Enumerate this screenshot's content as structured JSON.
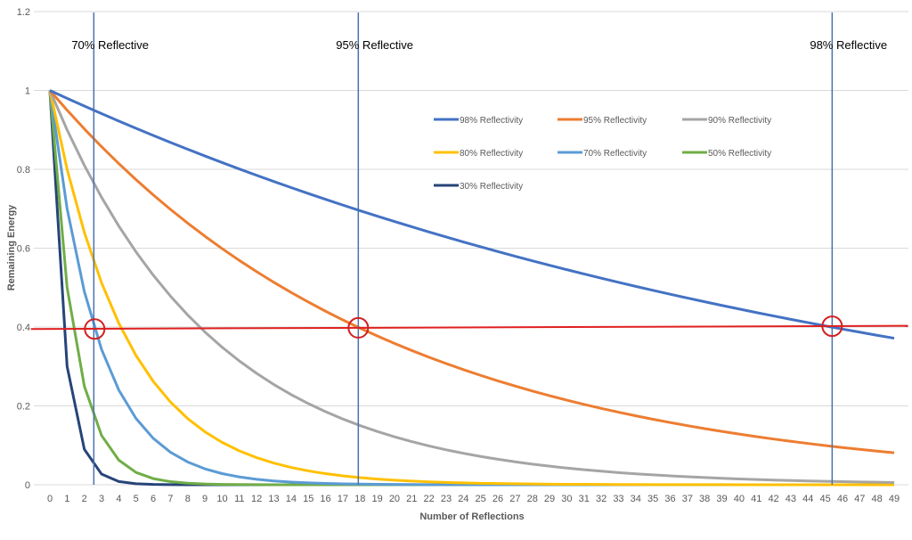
{
  "chart_data": {
    "type": "line",
    "title": "",
    "xlabel": "Number of Reflections",
    "ylabel": "Remaining Energy",
    "xlim": [
      0,
      49
    ],
    "ylim": [
      0,
      1.2
    ],
    "yticks": [
      0,
      0.2,
      0.4,
      0.6,
      0.8,
      1,
      1.2
    ],
    "ytick_labels": [
      "0",
      "0.2",
      "0.4",
      "0.6",
      "0.8",
      "1",
      "1.2"
    ],
    "x": [
      0,
      1,
      2,
      3,
      4,
      5,
      6,
      7,
      8,
      9,
      10,
      11,
      12,
      13,
      14,
      15,
      16,
      17,
      18,
      19,
      20,
      21,
      22,
      23,
      24,
      25,
      26,
      27,
      28,
      29,
      30,
      31,
      32,
      33,
      34,
      35,
      36,
      37,
      38,
      39,
      40,
      41,
      42,
      43,
      44,
      45,
      46,
      47,
      48,
      49
    ],
    "grid": "horizontal",
    "legend_position": "upper-right inside plot",
    "series": [
      {
        "name": "98% Reflectivity",
        "reflectivity": 0.98,
        "color": "#4472C4",
        "formula": "0.98^n"
      },
      {
        "name": "95% Reflectivity",
        "reflectivity": 0.95,
        "color": "#ED7D31",
        "formula": "0.95^n"
      },
      {
        "name": "90% Reflectivity",
        "reflectivity": 0.9,
        "color": "#A5A5A5",
        "formula": "0.90^n"
      },
      {
        "name": "80% Reflectivity",
        "reflectivity": 0.8,
        "color": "#FFC000",
        "formula": "0.80^n"
      },
      {
        "name": "70% Reflectivity",
        "reflectivity": 0.7,
        "color": "#5B9BD5",
        "formula": "0.70^n"
      },
      {
        "name": "50% Reflectivity",
        "reflectivity": 0.5,
        "color": "#70AD47",
        "formula": "0.50^n"
      },
      {
        "name": "30% Reflectivity",
        "reflectivity": 0.3,
        "color": "#264478",
        "formula": "0.30^n"
      }
    ],
    "threshold_line": {
      "label": "",
      "y_start": 0.395,
      "y_end": 0.403,
      "x_start": -1.1,
      "x_end": 49.8,
      "color": "#E02020"
    },
    "vertical_markers": [
      {
        "label": "70% Reflective",
        "x": 2.55,
        "color": "#4A72B0"
      },
      {
        "label": "95% Reflective",
        "x": 17.9,
        "color": "#4A72B0"
      },
      {
        "label": "98% Reflective",
        "x": 45.4,
        "color": "#4A72B0"
      }
    ],
    "intersection_circles": [
      {
        "x": 2.6,
        "y": 0.395,
        "color": "#D22020"
      },
      {
        "x": 17.9,
        "y": 0.398,
        "color": "#D22020"
      },
      {
        "x": 45.4,
        "y": 0.402,
        "color": "#D22020"
      }
    ]
  }
}
